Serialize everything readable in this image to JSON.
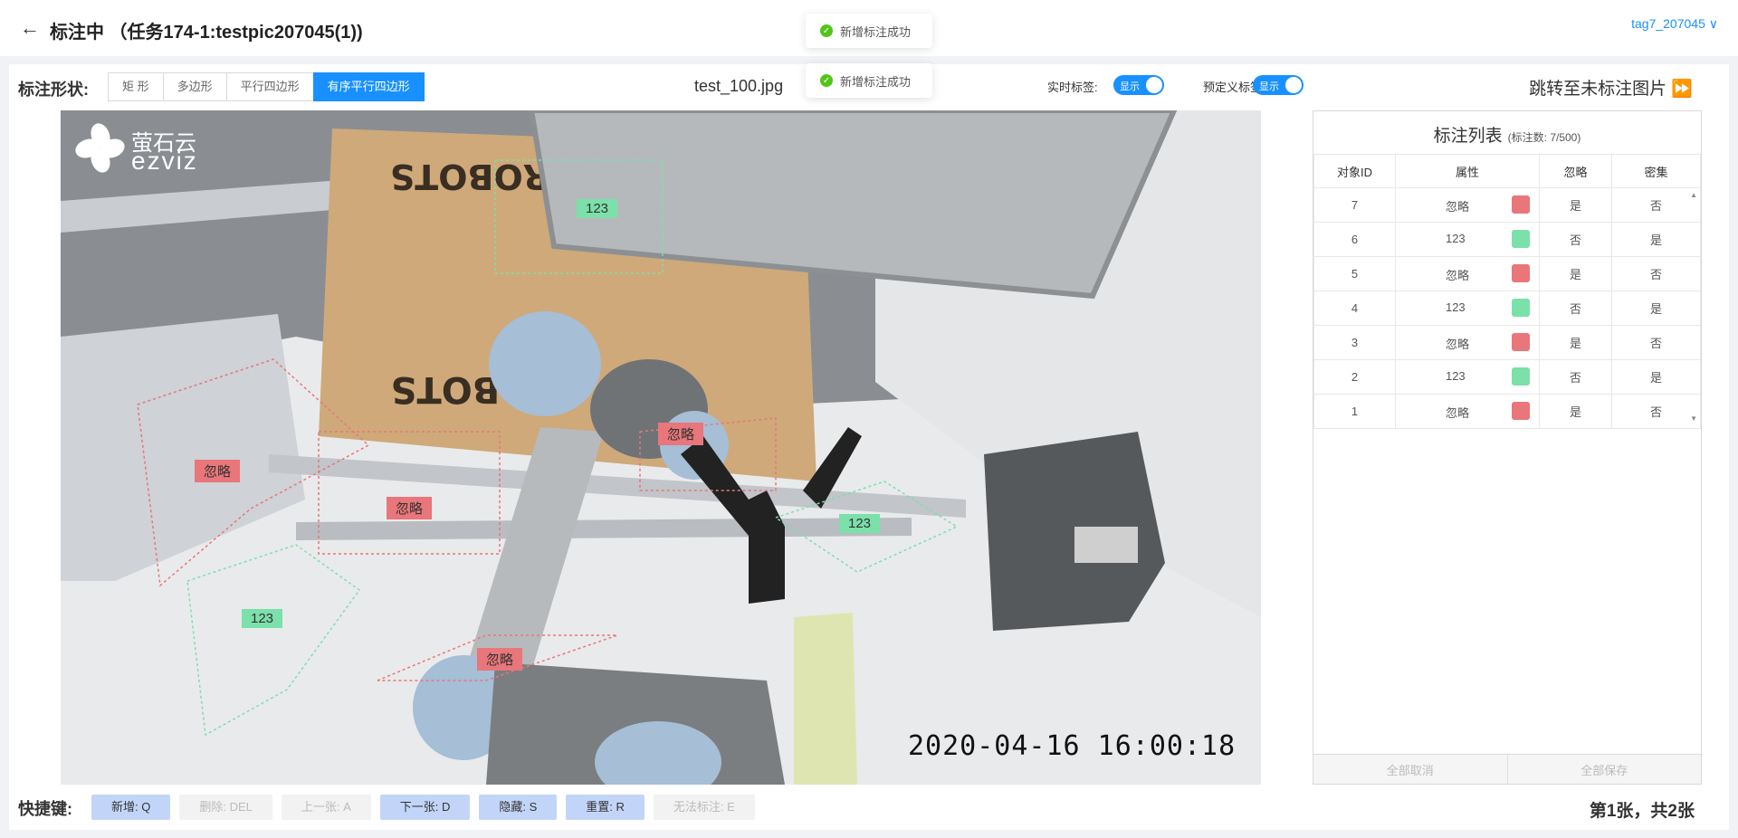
{
  "header": {
    "title": "标注中 （任务174-1:testpic207045(1))",
    "user": "tag7_207045 ∨"
  },
  "toasts": [
    "新增标注成功",
    "新增标注成功"
  ],
  "toolbar": {
    "shape_label": "标注形状:",
    "shapes": [
      "矩 形",
      "多边形",
      "平行四边形",
      "有序平行四边形"
    ],
    "active_shape": "有序平行四边形",
    "filename": "test_100.jpg",
    "realtime_label": "实时标签:",
    "realtime_value": "显示",
    "predef_label": "预定义标签:",
    "predef_value": "显示",
    "jump": "跳转至未标注图片 ⏩"
  },
  "image": {
    "logo_cn": "萤石云",
    "logo_en": "ezviz",
    "timestamp": "2020-04-16 16:00:18",
    "annotations": [
      {
        "label": "123",
        "color": "#7be0aa"
      },
      {
        "label": "忽略",
        "color": "#e8767a"
      },
      {
        "label": "忽略",
        "color": "#e8767a"
      },
      {
        "label": "忽略",
        "color": "#e8767a"
      },
      {
        "label": "123",
        "color": "#7be0aa"
      },
      {
        "label": "123",
        "color": "#7be0aa"
      },
      {
        "label": "忽略",
        "color": "#e8767a"
      }
    ]
  },
  "panel": {
    "title": "标注列表",
    "count": "(标注数: 7/500)",
    "columns": [
      "对象ID",
      "属性",
      "忽略",
      "密集"
    ],
    "rows": [
      {
        "id": "7",
        "attr": "忽略",
        "color": "#e8767a",
        "ignore": "是",
        "dense": "否"
      },
      {
        "id": "6",
        "attr": "123",
        "color": "#7be0aa",
        "ignore": "否",
        "dense": "是"
      },
      {
        "id": "5",
        "attr": "忽略",
        "color": "#e8767a",
        "ignore": "是",
        "dense": "否"
      },
      {
        "id": "4",
        "attr": "123",
        "color": "#7be0aa",
        "ignore": "否",
        "dense": "是"
      },
      {
        "id": "3",
        "attr": "忽略",
        "color": "#e8767a",
        "ignore": "是",
        "dense": "否"
      },
      {
        "id": "2",
        "attr": "123",
        "color": "#7be0aa",
        "ignore": "否",
        "dense": "是"
      },
      {
        "id": "1",
        "attr": "忽略",
        "color": "#e8767a",
        "ignore": "是",
        "dense": "否"
      }
    ],
    "cancel_all": "全部取消",
    "save_all": "全部保存"
  },
  "hotkeys": {
    "label": "快捷键:",
    "keys": [
      {
        "label": "新增: Q",
        "enabled": true
      },
      {
        "label": "删除: DEL",
        "enabled": false
      },
      {
        "label": "上一张: A",
        "enabled": false
      },
      {
        "label": "下一张: D",
        "enabled": true
      },
      {
        "label": "隐藏: S",
        "enabled": true
      },
      {
        "label": "重置: R",
        "enabled": true
      },
      {
        "label": "无法标注: E",
        "enabled": false
      }
    ]
  },
  "pagination": {
    "info": "第1张，共2张"
  }
}
